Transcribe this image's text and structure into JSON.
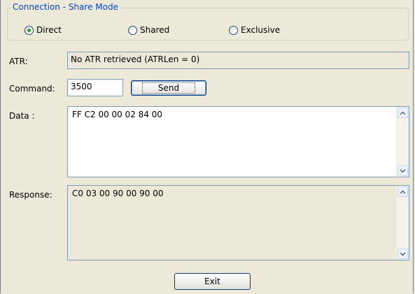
{
  "share_mode": {
    "title": "Connection - Share Mode",
    "options": [
      {
        "label": "Direct",
        "selected": true
      },
      {
        "label": "Shared",
        "selected": false
      },
      {
        "label": "Exclusive",
        "selected": false
      }
    ]
  },
  "atr": {
    "label": "ATR:",
    "value": "No ATR retrieved (ATRLen = 0)"
  },
  "command": {
    "label": "Command:",
    "value": "3500",
    "send_label": "Send"
  },
  "data": {
    "label": "Data :",
    "value": "FF C2 00 00 02 84 00"
  },
  "response": {
    "label": "Response:",
    "value": "C0 03 00 90 00 90 00"
  },
  "exit_label": "Exit"
}
